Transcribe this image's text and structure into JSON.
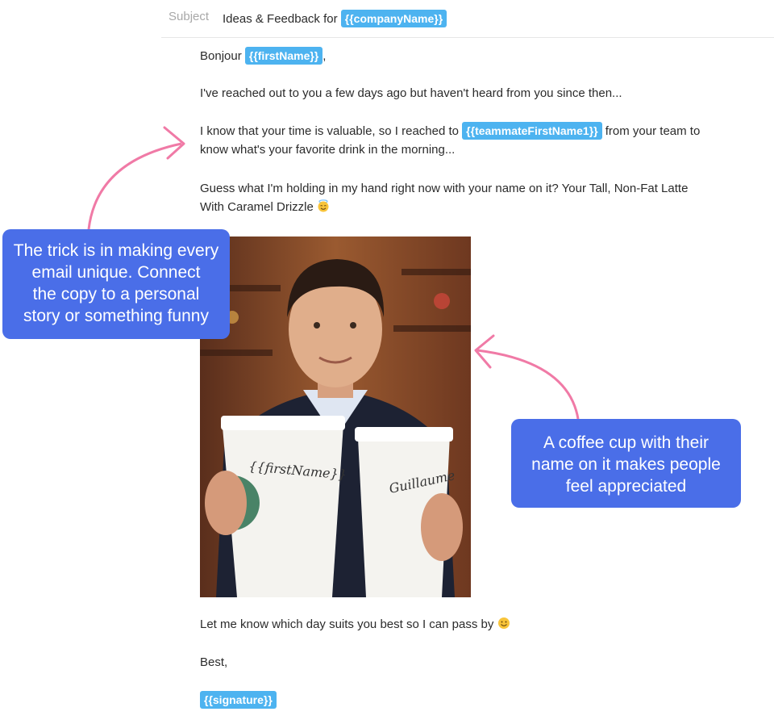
{
  "subject": {
    "label": "Subject",
    "text": "Ideas & Feedback for",
    "tag": "{{companyName}}"
  },
  "email": {
    "greeting": "Bonjour",
    "greeting_tag": "{{firstName}}",
    "greeting_suffix": ",",
    "p1": "I've reached out to you a few days ago but haven't heard from you since then...",
    "p2_start": "I know that your time is valuable, so I reached to",
    "p2_tag": "{{teammateFirstName1}}",
    "p2_end": "from your team to",
    "p2_line2": "know what's your favorite drink in the morning...",
    "p3_line1": "Guess what I'm holding in my hand right now with your name on it? Your Tall, Non-Fat Latte",
    "p3_line2": "With Caramel Drizzle",
    "p3_emoji": "halo-smile-emoji",
    "p4": "Let me know which day suits you best so I can pass by",
    "p4_emoji": "smile-emoji",
    "closing": "Best,",
    "signature_tag": "{{signature}}"
  },
  "photo": {
    "cup_left_text": "{{firstName}}",
    "cup_right_text": "Guillaume"
  },
  "callouts": {
    "left": [
      "The trick is in making every",
      "email unique. Connect",
      "the copy to a personal",
      "story or something funny"
    ],
    "right": [
      "A coffee cup with their",
      "name on it makes people",
      "feel appreciated"
    ]
  },
  "colors": {
    "tag_bg": "#4db3f0",
    "callout_bg": "#4a6ee8",
    "arrow": "#f07aa6"
  }
}
